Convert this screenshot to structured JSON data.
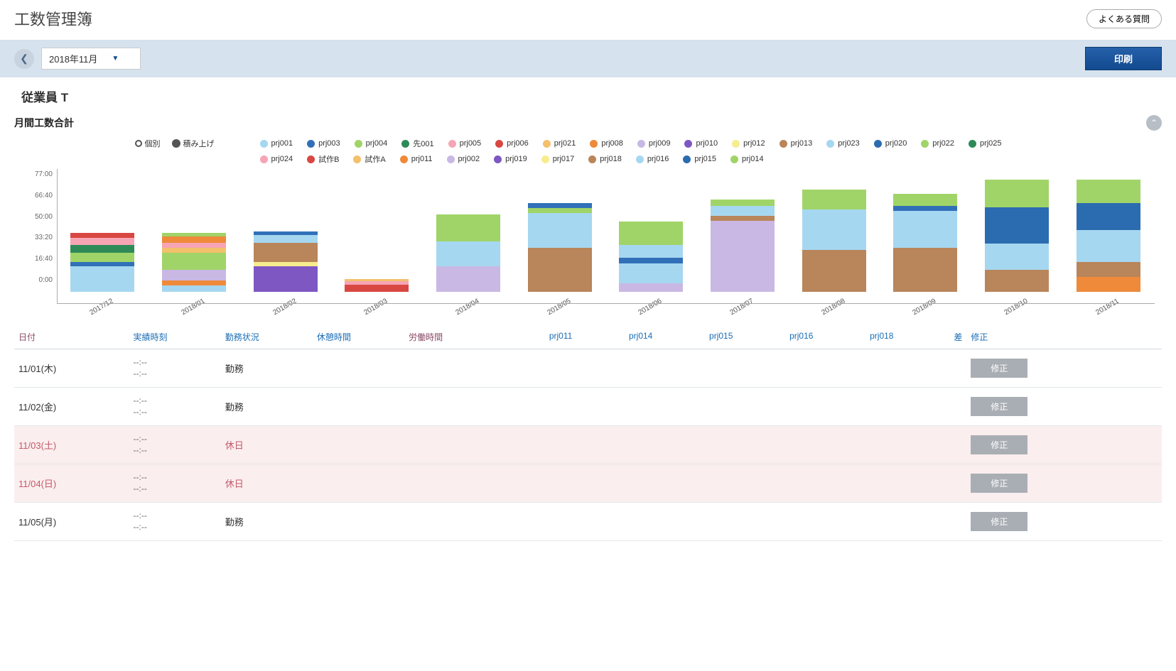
{
  "header": {
    "title": "工数管理簿",
    "faq": "よくある質問"
  },
  "toolbar": {
    "month": "2018年11月",
    "print": "印刷"
  },
  "employee": "従業員 T",
  "chart": {
    "title": "月間工数合計",
    "mode_individual": "個別",
    "mode_stacked": "積み上げ"
  },
  "legend": [
    {
      "id": "prj001",
      "label": "prj001",
      "color": "#a6d7f0"
    },
    {
      "id": "prj003",
      "label": "prj003",
      "color": "#3170b8"
    },
    {
      "id": "prj004",
      "label": "prj004",
      "color": "#a0d468"
    },
    {
      "id": "sen001",
      "label": "先001",
      "color": "#2e8b57"
    },
    {
      "id": "prj005",
      "label": "prj005",
      "color": "#f6a5b4"
    },
    {
      "id": "prj006",
      "label": "prj006",
      "color": "#d94742"
    },
    {
      "id": "prj021",
      "label": "prj021",
      "color": "#f3c06b"
    },
    {
      "id": "prj008",
      "label": "prj008",
      "color": "#ee8a3a"
    },
    {
      "id": "prj009",
      "label": "prj009",
      "color": "#c9b8e4"
    },
    {
      "id": "prj010",
      "label": "prj010",
      "color": "#7e57c2"
    },
    {
      "id": "prj012",
      "label": "prj012",
      "color": "#f7ec8e"
    },
    {
      "id": "prj013",
      "label": "prj013",
      "color": "#b9855a"
    },
    {
      "id": "prj023",
      "label": "prj023",
      "color": "#a6d7f0"
    },
    {
      "id": "prj020",
      "label": "prj020",
      "color": "#2b6cb0"
    },
    {
      "id": "prj022",
      "label": "prj022",
      "color": "#a0d468"
    },
    {
      "id": "prj025",
      "label": "prj025",
      "color": "#2e8b57"
    },
    {
      "id": "prj024",
      "label": "prj024",
      "color": "#f6a5b4"
    },
    {
      "id": "shisakuB",
      "label": "試作B",
      "color": "#d94742"
    },
    {
      "id": "shisakuA",
      "label": "試作A",
      "color": "#f3c06b"
    },
    {
      "id": "prj011",
      "label": "prj011",
      "color": "#ee8a3a"
    },
    {
      "id": "prj002",
      "label": "prj002",
      "color": "#c9b8e4"
    },
    {
      "id": "prj019",
      "label": "prj019",
      "color": "#7e57c2"
    },
    {
      "id": "prj017",
      "label": "prj017",
      "color": "#f7ec8e"
    },
    {
      "id": "prj018",
      "label": "prj018",
      "color": "#b9855a"
    },
    {
      "id": "prj016",
      "label": "prj016",
      "color": "#a6d7f0"
    },
    {
      "id": "prj015",
      "label": "prj015",
      "color": "#2b6cb0"
    },
    {
      "id": "prj014",
      "label": "prj014",
      "color": "#a0d468"
    }
  ],
  "chart_data": {
    "type": "bar",
    "ylabel": "",
    "ymax_minutes": 4620,
    "yticks": [
      "77:00",
      "66:40",
      "50:00",
      "33:20",
      "16:40",
      "0:00"
    ],
    "categories": [
      "2017/12",
      "2018/01",
      "2018/02",
      "2018/03",
      "2018/04",
      "2018/05",
      "2018/06",
      "2018/07",
      "2018/08",
      "2018/09",
      "2018/10",
      "2018/11"
    ],
    "stacks": [
      [
        {
          "series": "prj001",
          "minutes": 1050
        },
        {
          "series": "prj003",
          "minutes": 150
        },
        {
          "series": "prj004",
          "minutes": 400
        },
        {
          "series": "sen001",
          "minutes": 300
        },
        {
          "series": "prj005",
          "minutes": 300
        },
        {
          "series": "prj006",
          "minutes": 200
        }
      ],
      [
        {
          "series": "prj001",
          "minutes": 250
        },
        {
          "series": "prj008",
          "minutes": 200
        },
        {
          "series": "prj009",
          "minutes": 450
        },
        {
          "series": "prj004",
          "minutes": 700
        },
        {
          "series": "prj021",
          "minutes": 200
        },
        {
          "series": "prj005",
          "minutes": 200
        },
        {
          "series": "prj008",
          "minutes": 250
        },
        {
          "series": "prj004",
          "minutes": 150
        }
      ],
      [
        {
          "series": "prj010",
          "minutes": 1050
        },
        {
          "series": "prj012",
          "minutes": 150
        },
        {
          "series": "prj013",
          "minutes": 800
        },
        {
          "series": "prj001",
          "minutes": 300
        },
        {
          "series": "prj003",
          "minutes": 150
        }
      ],
      [
        {
          "series": "shisakuB",
          "minutes": 300
        },
        {
          "series": "prj005",
          "minutes": 120
        },
        {
          "series": "shisakuA",
          "minutes": 100
        }
      ],
      [
        {
          "series": "prj002",
          "minutes": 1050
        },
        {
          "series": "prj001",
          "minutes": 1000
        },
        {
          "series": "prj004",
          "minutes": 1100
        }
      ],
      [
        {
          "series": "prj013",
          "minutes": 1800
        },
        {
          "series": "prj001",
          "minutes": 1400
        },
        {
          "series": "prj004",
          "minutes": 200
        },
        {
          "series": "prj003",
          "minutes": 200
        }
      ],
      [
        {
          "series": "prj002",
          "minutes": 350
        },
        {
          "series": "prj001",
          "minutes": 800
        },
        {
          "series": "prj003",
          "minutes": 250
        },
        {
          "series": "prj001",
          "minutes": 500
        },
        {
          "series": "prj004",
          "minutes": 950
        }
      ],
      [
        {
          "series": "prj002",
          "minutes": 2900
        },
        {
          "series": "prj013",
          "minutes": 200
        },
        {
          "series": "prj001",
          "minutes": 400
        },
        {
          "series": "prj004",
          "minutes": 250
        }
      ],
      [
        {
          "series": "prj013",
          "minutes": 1700
        },
        {
          "series": "prj001",
          "minutes": 1650
        },
        {
          "series": "prj004",
          "minutes": 800
        }
      ],
      [
        {
          "series": "prj013",
          "minutes": 1800
        },
        {
          "series": "prj001",
          "minutes": 1500
        },
        {
          "series": "prj003",
          "minutes": 200
        },
        {
          "series": "prj004",
          "minutes": 500
        }
      ],
      [
        {
          "series": "prj018",
          "minutes": 900
        },
        {
          "series": "prj016",
          "minutes": 1050
        },
        {
          "series": "prj015",
          "minutes": 1500
        },
        {
          "series": "prj014",
          "minutes": 1100
        }
      ],
      [
        {
          "series": "prj011",
          "minutes": 600
        },
        {
          "series": "prj018",
          "minutes": 600
        },
        {
          "series": "prj016",
          "minutes": 1300
        },
        {
          "series": "prj015",
          "minutes": 1100
        },
        {
          "series": "prj014",
          "minutes": 950
        }
      ]
    ]
  },
  "table": {
    "headers": {
      "date": "日付",
      "actual": "実績時刻",
      "status": "勤務状況",
      "break": "休憩時間",
      "work": "労働時間",
      "p1": "prj011",
      "p2": "prj014",
      "p3": "prj015",
      "p4": "prj016",
      "p5": "prj018",
      "diff": "差",
      "edit": "修正"
    },
    "edit_label": "修正",
    "empty_time": "--:--",
    "rows": [
      {
        "date": "11/01(木)",
        "status": "勤務",
        "holiday": false
      },
      {
        "date": "11/02(金)",
        "status": "勤務",
        "holiday": false
      },
      {
        "date": "11/03(土)",
        "status": "休日",
        "holiday": true
      },
      {
        "date": "11/04(日)",
        "status": "休日",
        "holiday": true
      },
      {
        "date": "11/05(月)",
        "status": "勤務",
        "holiday": false
      }
    ]
  }
}
